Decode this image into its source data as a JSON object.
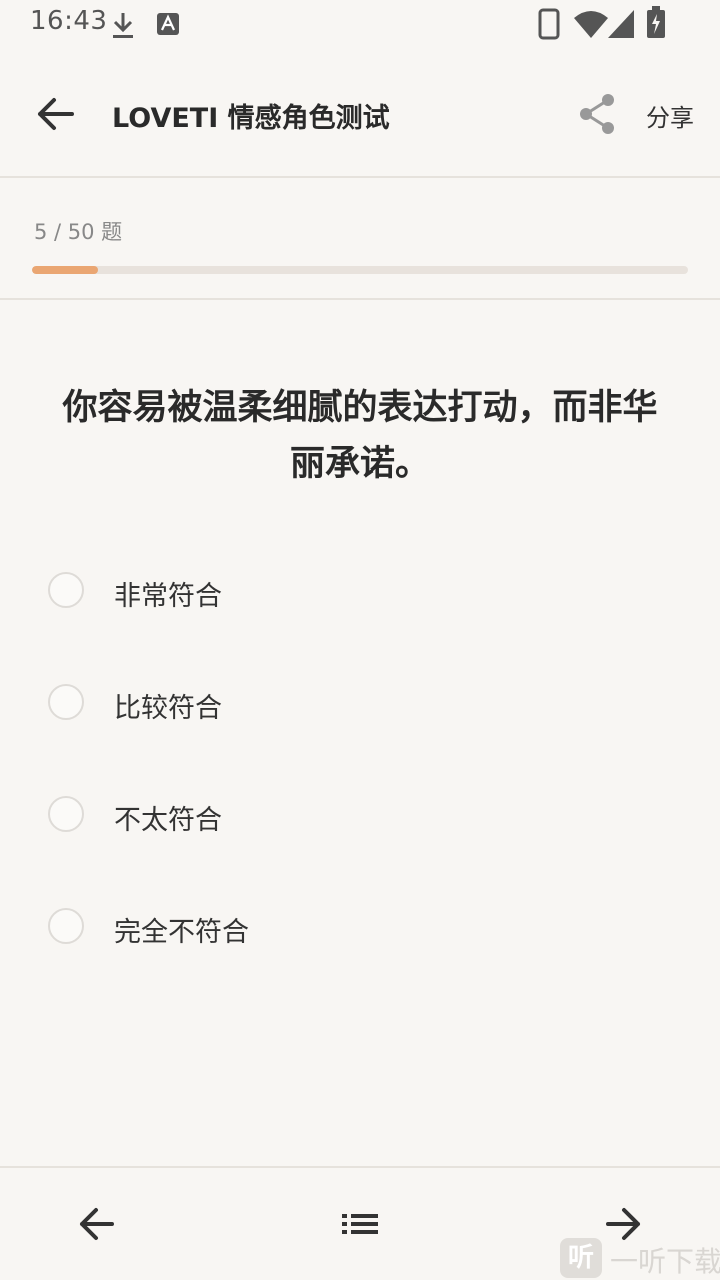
{
  "status_bar": {
    "time": "16:43",
    "icons": [
      "download-icon",
      "text-a-icon",
      "phone-icon",
      "wifi-icon",
      "signal-icon",
      "battery-charging-icon"
    ]
  },
  "app_bar": {
    "title": "LOVETI 情感角色测试",
    "share_label": "分享",
    "icons": [
      "back-arrow-icon",
      "share-icon"
    ]
  },
  "progress": {
    "text": "5 / 50 题",
    "current": 5,
    "total": 50,
    "fraction": 0.1,
    "fill_color": "#eaa672",
    "track_color": "#e8e2dc"
  },
  "question": {
    "text": "你容易被温柔细腻的表达打动，而非华丽承诺。"
  },
  "options": [
    {
      "label": "非常符合",
      "selected": false
    },
    {
      "label": "比较符合",
      "selected": false
    },
    {
      "label": "不太符合",
      "selected": false
    },
    {
      "label": "完全不符合",
      "selected": false
    }
  ],
  "bottom_nav": {
    "icons": [
      "prev-arrow-icon",
      "list-icon",
      "next-arrow-icon"
    ]
  },
  "watermark": {
    "badge": "听",
    "text": "一听下载"
  }
}
